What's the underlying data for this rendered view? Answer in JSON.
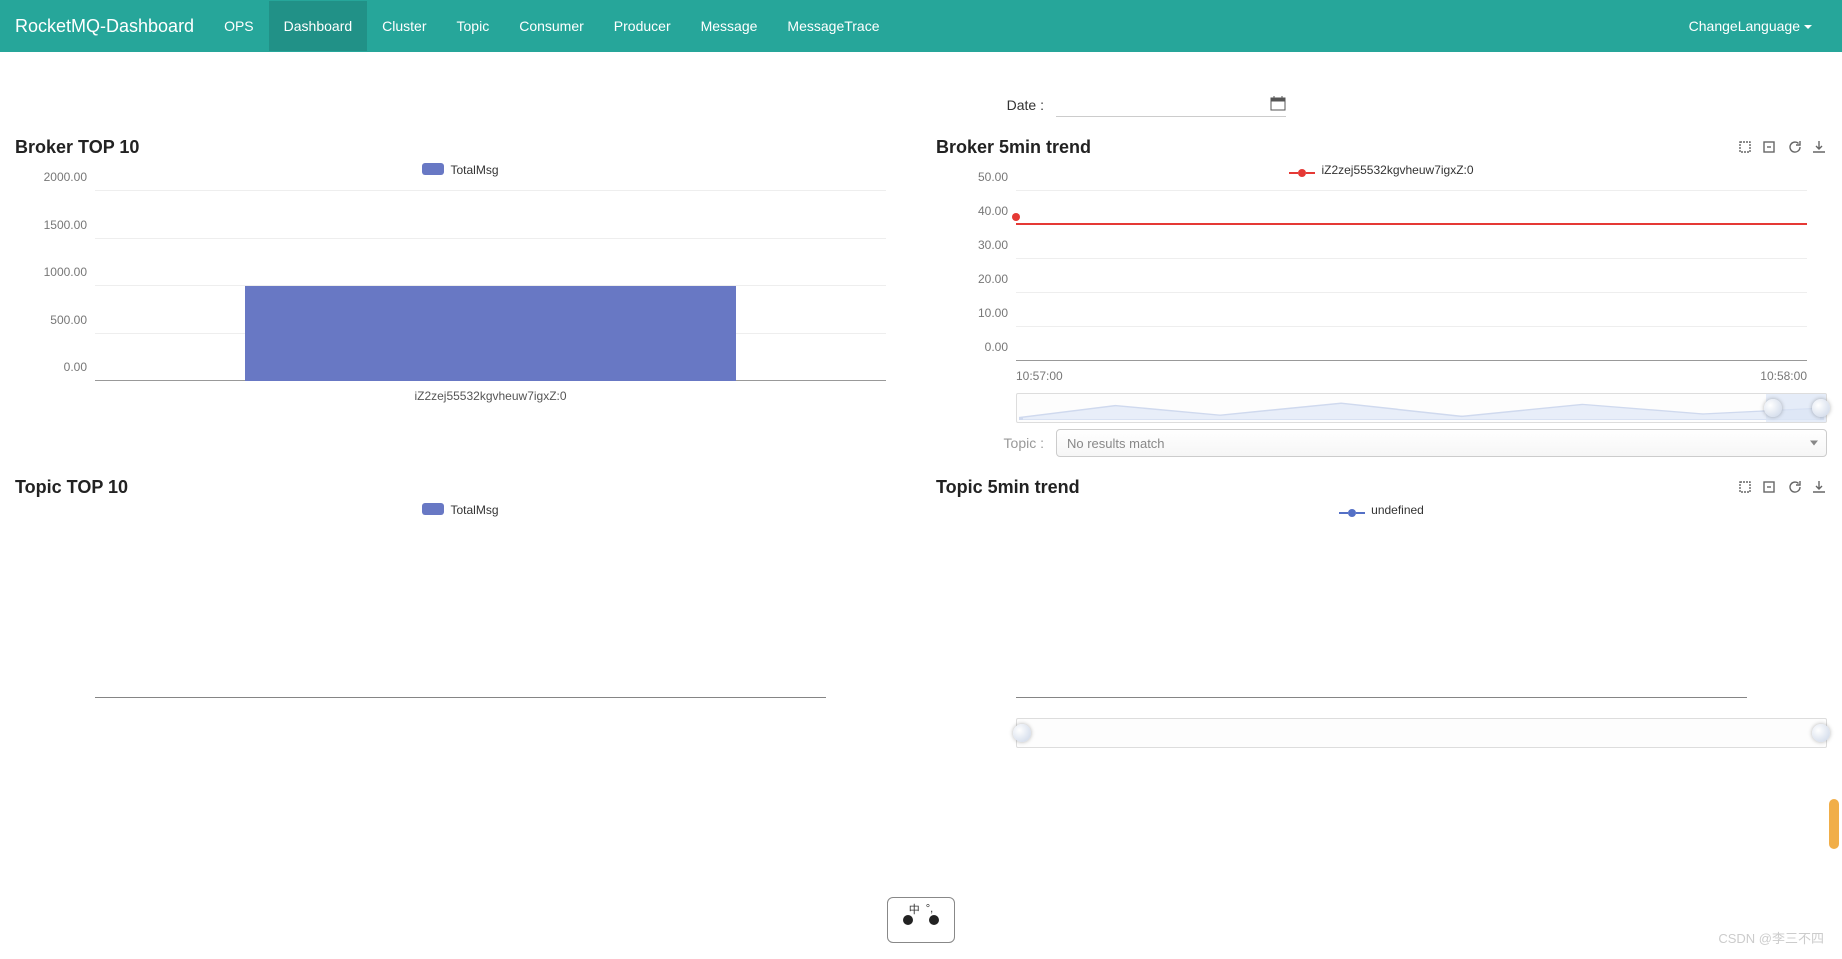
{
  "brand": "RocketMQ-Dashboard",
  "nav": {
    "items": [
      {
        "label": "OPS",
        "key": "ops"
      },
      {
        "label": "Dashboard",
        "key": "dashboard",
        "active": true
      },
      {
        "label": "Cluster",
        "key": "cluster"
      },
      {
        "label": "Topic",
        "key": "topic"
      },
      {
        "label": "Consumer",
        "key": "consumer"
      },
      {
        "label": "Producer",
        "key": "producer"
      },
      {
        "label": "Message",
        "key": "message"
      },
      {
        "label": "MessageTrace",
        "key": "messagetrace"
      }
    ],
    "language": "ChangeLanguage"
  },
  "date_label": "Date :",
  "topic_label": "Topic :",
  "topic_select_placeholder": "No results match",
  "colors": {
    "bar": "#6878c4",
    "line_red": "#e53935",
    "line_blue": "#5470c6"
  },
  "broker_top10": {
    "title": "Broker TOP 10",
    "legend": "TotalMsg",
    "chart_data": {
      "type": "bar",
      "categories": [
        "iZ2zej55532kgvheuw7igxZ:0"
      ],
      "values": [
        1000
      ],
      "ylim": [
        0,
        2000
      ],
      "yticks": [
        "0.00",
        "500.00",
        "1000.00",
        "1500.00",
        "2000.00"
      ]
    }
  },
  "broker_5min": {
    "title": "Broker 5min trend",
    "legend": "iZ2zej55532kgvheuw7igxZ:0",
    "chart_data": {
      "type": "line",
      "x": [
        "10:57:00",
        "10:58:00"
      ],
      "series": [
        {
          "name": "iZ2zej55532kgvheuw7igxZ:0",
          "values": [
            40,
            40
          ]
        }
      ],
      "ylim": [
        0,
        50
      ],
      "yticks": [
        "0.00",
        "10.00",
        "20.00",
        "30.00",
        "40.00",
        "50.00"
      ]
    }
  },
  "topic_top10": {
    "title": "Topic TOP 10",
    "legend": "TotalMsg",
    "chart_data": {
      "type": "bar",
      "categories": [],
      "values": [],
      "ylim": [
        0,
        0
      ]
    }
  },
  "topic_5min": {
    "title": "Topic 5min trend",
    "legend": "undefined",
    "chart_data": {
      "type": "line",
      "x": [],
      "series": [
        {
          "name": "undefined",
          "values": []
        }
      ],
      "ylim": [
        0,
        0
      ]
    }
  },
  "watermark": "CSDN @李三不四",
  "ime_label": "中"
}
